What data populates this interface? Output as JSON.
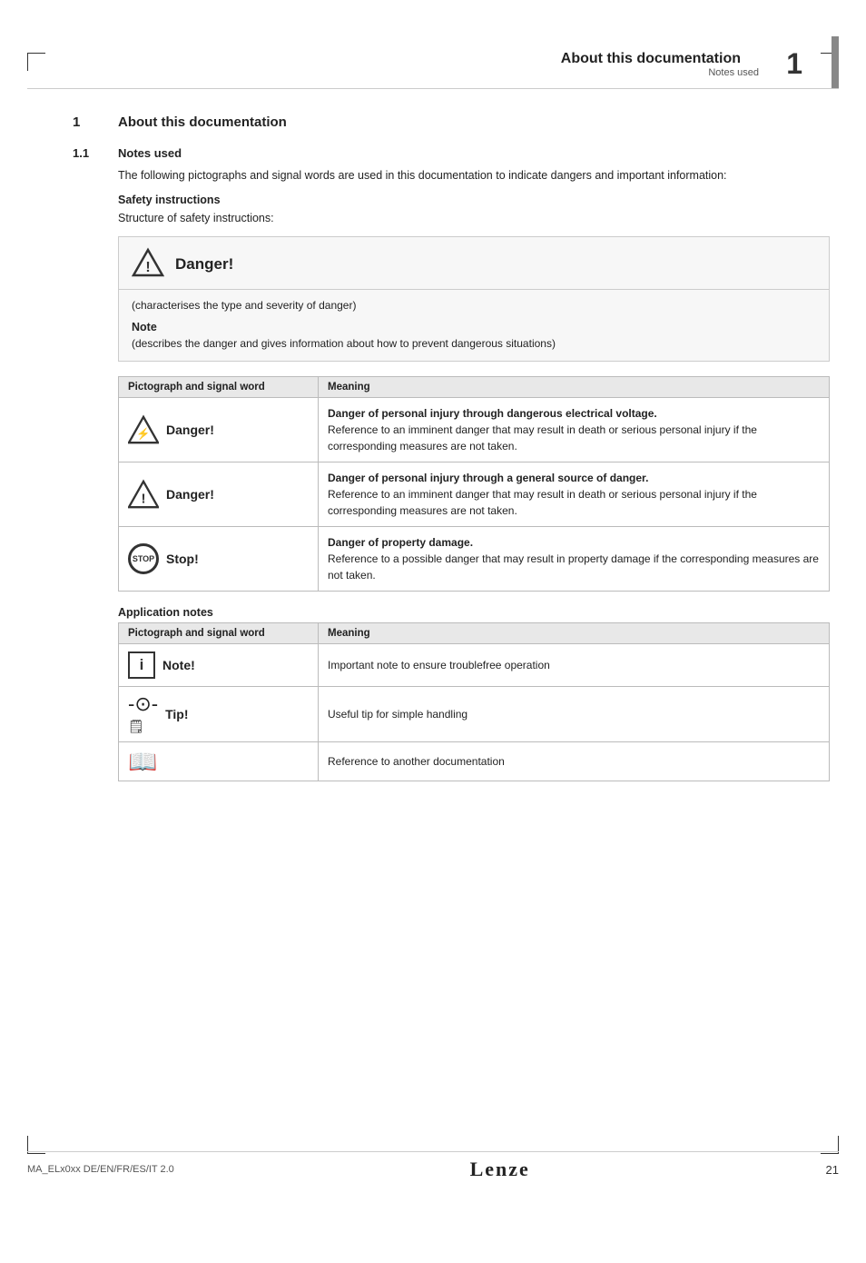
{
  "header": {
    "title": "About this documentation",
    "subtitle": "Notes used",
    "chapter_number": "1"
  },
  "section": {
    "number": "1",
    "title": "About this documentation"
  },
  "subsection": {
    "number": "1.1",
    "title": "Notes used"
  },
  "intro_text": "The following pictographs and signal words are used in this documentation to indicate dangers and important information:",
  "safety_instructions_label": "Safety instructions",
  "safety_structure_label": "Structure of safety instructions:",
  "safety_box": {
    "signal_word": "Danger!",
    "char_text": "(characterises the type and severity of danger)",
    "note_label": "Note",
    "note_text": "(describes the danger and gives information about how to prevent dangerous situations)"
  },
  "safety_table": {
    "col1": "Pictograph and signal word",
    "col2": "Meaning",
    "rows": [
      {
        "icon_type": "tri-electrical",
        "signal_word": "Danger!",
        "meaning_bold": "Danger of personal injury through dangerous electrical voltage.",
        "meaning_text": "Reference to an imminent danger that may result in death or serious personal injury if the corresponding measures are not taken."
      },
      {
        "icon_type": "tri-general",
        "signal_word": "Danger!",
        "meaning_bold": "Danger of personal injury through a general source of danger.",
        "meaning_text": "Reference to an imminent danger that may result in death or serious personal injury if the corresponding measures are not taken."
      },
      {
        "icon_type": "stop",
        "signal_word": "Stop!",
        "meaning_bold": "Danger of property damage.",
        "meaning_text": "Reference to a possible danger that may result in property damage if the corresponding measures are not taken."
      }
    ]
  },
  "application_notes_label": "Application notes",
  "app_table": {
    "col1": "Pictograph and signal word",
    "col2": "Meaning",
    "rows": [
      {
        "icon_type": "info",
        "signal_word": "Note!",
        "meaning_text": "Important note to ensure troublefree operation"
      },
      {
        "icon_type": "tip",
        "signal_word": "Tip!",
        "meaning_text": "Useful tip for simple handling"
      },
      {
        "icon_type": "book",
        "signal_word": "",
        "meaning_text": "Reference to another documentation"
      }
    ]
  },
  "footer": {
    "left_text": "MA_ELx0xx  DE/EN/FR/ES/IT  2.0",
    "brand": "Lenze",
    "page": "21"
  }
}
